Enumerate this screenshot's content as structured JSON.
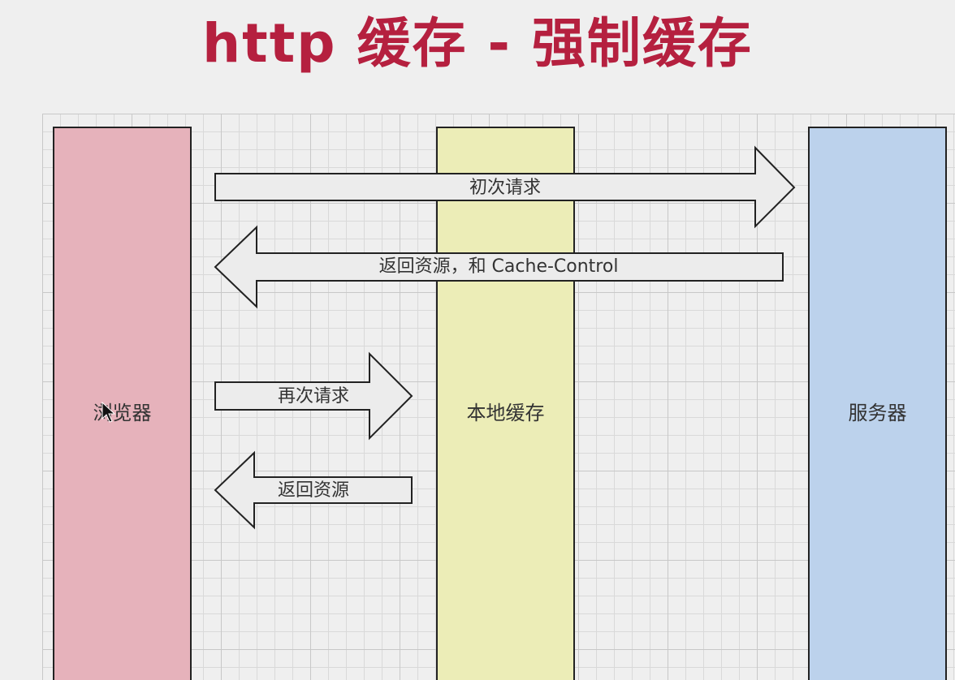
{
  "title": "http 缓存 - 强制缓存",
  "columns": {
    "browser": "浏览器",
    "cache": "本地缓存",
    "server": "服务器"
  },
  "arrows": {
    "first_request": "初次请求",
    "return_with_cache_control": "返回资源，和 Cache-Control",
    "second_request": "再次请求",
    "return_resource": "返回资源"
  },
  "colors": {
    "title": "#b5203f",
    "browser": "#e6b2bb",
    "cache": "#ecedb7",
    "server": "#bcd2ec",
    "arrow_fill": "#ececec",
    "arrow_stroke": "#222222"
  }
}
